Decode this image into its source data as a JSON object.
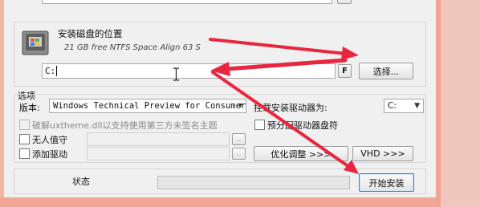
{
  "disk_location": {
    "title": "安装磁盘的位置",
    "detail": "21 GB free NTFS Space Align 63 S",
    "path_value": "C:",
    "f_button": "F",
    "choose_button": "选择..."
  },
  "options": {
    "group_label": "选项",
    "version_label": "版本:",
    "version_value": "Windows Technical Preview for Consumer",
    "mount_label": "挂载安装驱动器为:",
    "mount_value": "C:",
    "crack_label": "破解uxtheme.dll以支持使用第三方未签名主题",
    "unattended_label": "无人值守",
    "add_driver_label": "添加驱动",
    "browse_label": "..",
    "pre_assign_label": "预分配驱动器盘符",
    "optimize_button": "优化调整 >>>",
    "vhd_button": "VHD >>>"
  },
  "status": {
    "label": "状态",
    "progress": 0,
    "start_button": "开始安装"
  },
  "colors": {
    "annotation_arrow": "#e8263f",
    "frame": "#f2a693",
    "window_bg": "#f0f0f0"
  }
}
